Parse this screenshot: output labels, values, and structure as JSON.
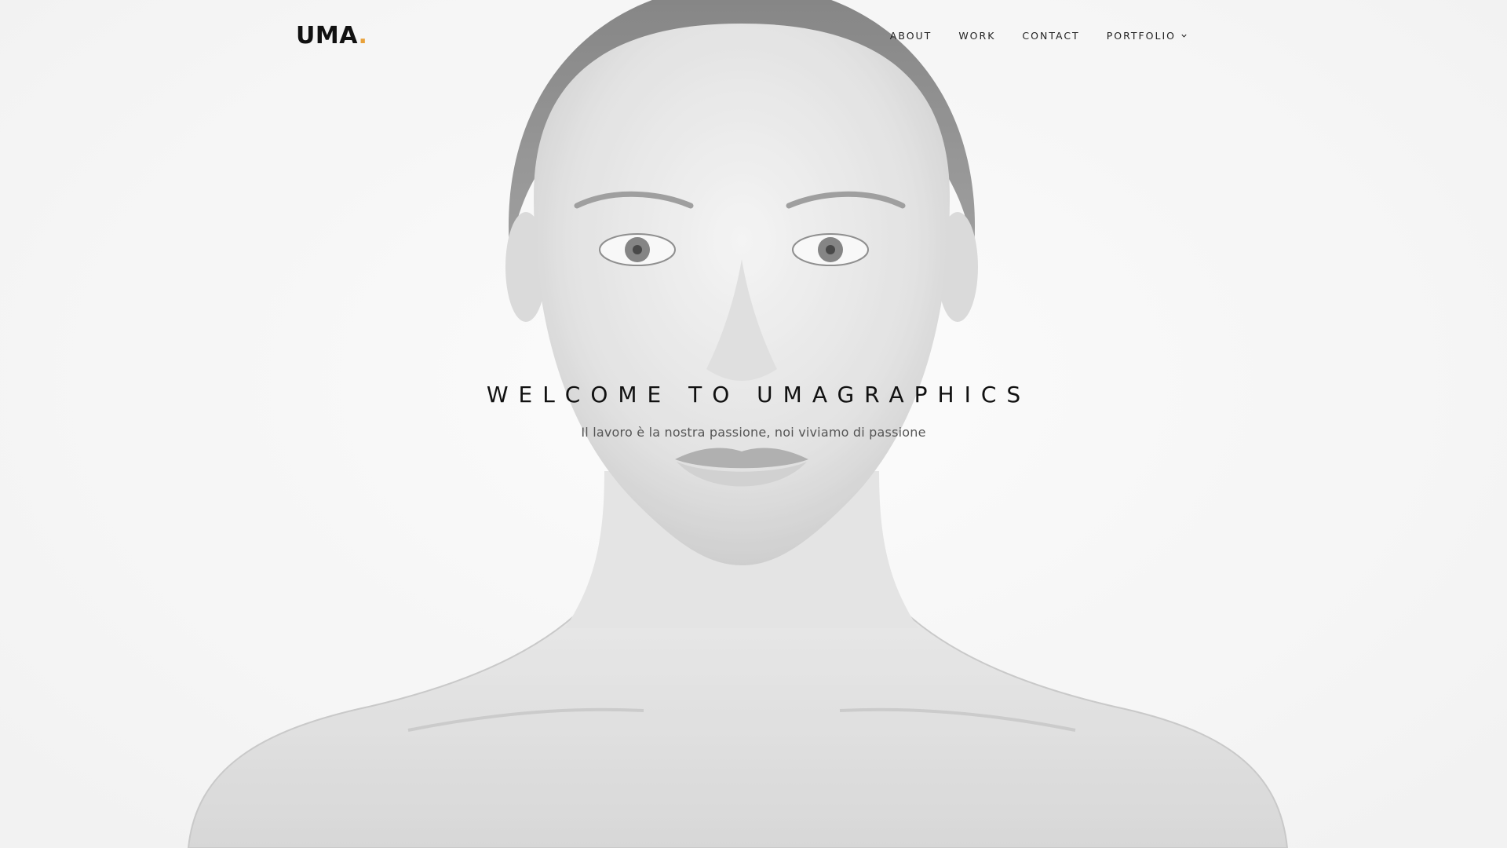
{
  "header": {
    "logo_text": "UMA",
    "logo_dot": ".",
    "nav": [
      {
        "label": "ABOUT"
      },
      {
        "label": "WORK"
      },
      {
        "label": "CONTACT"
      },
      {
        "label": "PORTFOLIO",
        "icon": "chevron-down-icon"
      }
    ]
  },
  "hero": {
    "title": "WELCOME TO UMAGRAPHICS",
    "subtitle": "Il lavoro è la nostra passione, noi viviamo di passione",
    "image": "black-and-white-portrait-of-woman"
  },
  "colors": {
    "accent": "#e8a13a",
    "text": "#111111",
    "subtext": "#555555",
    "background": "#f7f7f7"
  }
}
